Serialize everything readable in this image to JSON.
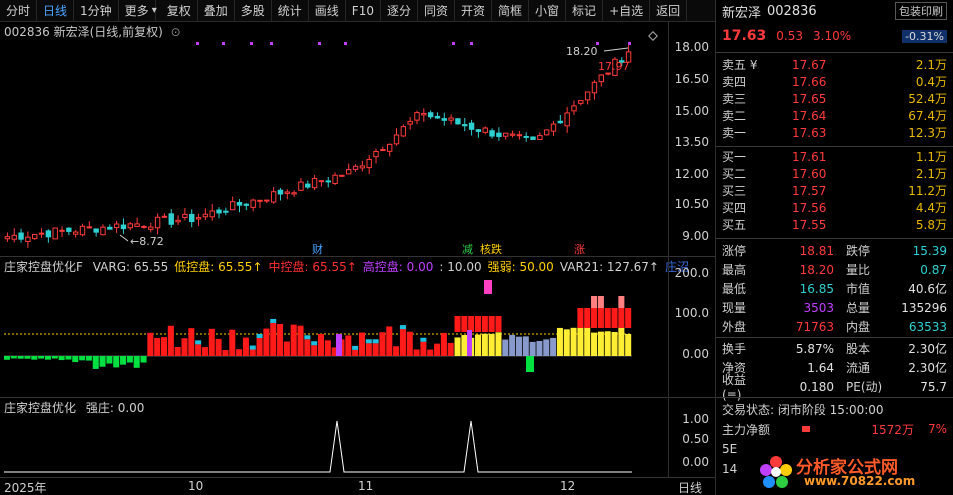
{
  "toolbar": {
    "items": [
      "分时",
      "日线",
      "1分钟",
      "更多",
      "复权",
      "叠加",
      "多股",
      "统计",
      "画线",
      "F10",
      "逐分",
      "同资",
      "开资",
      "简框",
      "小窗",
      "标记",
      "+自选",
      "返回"
    ],
    "active_index": 1,
    "more_caret": "▾"
  },
  "main_chart": {
    "title": "002836 新宏泽(日线,前复权)",
    "circle_icon": "⊙",
    "high_label": "18.20",
    "high_partial": "17.97",
    "low_label": "8.72",
    "markers": [
      "财",
      "减",
      "核跌",
      "涨"
    ],
    "y_ticks": [
      "18.00",
      "16.50",
      "15.00",
      "13.50",
      "12.00",
      "10.50",
      "9.00"
    ]
  },
  "panel2": {
    "title": "庄家控盘优化F",
    "items": [
      {
        "label": "VARG: 65.55",
        "color": "#d0d0d0"
      },
      {
        "label": "低控盘: 65.55↑",
        "color": "#ffd000"
      },
      {
        "label": "中控盘: 65.55↑",
        "color": "#ff3030"
      },
      {
        "label": "高控盘: 0.00",
        "color": "#c040ff"
      },
      {
        "label": ": 10.00",
        "color": "#d0d0d0"
      },
      {
        "label": "强弱: 50.00",
        "color": "#ffd000"
      },
      {
        "label": "VAR21: 127.67↑",
        "color": "#d0d0d0"
      },
      {
        "label": "庄沼",
        "color": "#3a6bd8"
      }
    ],
    "y_ticks": [
      "200.0",
      "100.0",
      "0.00"
    ]
  },
  "panel3": {
    "title": "庄家控盘优化",
    "value": "强庄: 0.00",
    "y_ticks": [
      "1.00",
      "0.50",
      "0.00"
    ]
  },
  "x_axis": [
    "2025年",
    "10",
    "11",
    "12",
    "日线"
  ],
  "quote": {
    "name": "新宏泽",
    "code": "002836",
    "print_btn": "包装印刷",
    "price": "17.63",
    "change": "0.53",
    "change_pct": "3.10%",
    "badge": "-0.31%",
    "sell": [
      {
        "label": "卖五 ¥",
        "price": "17.67",
        "vol": "2.1万"
      },
      {
        "label": "卖四",
        "price": "17.66",
        "vol": "0.4万"
      },
      {
        "label": "卖三",
        "price": "17.65",
        "vol": "52.4万"
      },
      {
        "label": "卖二",
        "price": "17.64",
        "vol": "67.4万"
      },
      {
        "label": "卖一",
        "price": "17.63",
        "vol": "12.3万"
      }
    ],
    "buy": [
      {
        "label": "买一",
        "price": "17.61",
        "vol": "1.1万"
      },
      {
        "label": "买二",
        "price": "17.60",
        "vol": "2.1万"
      },
      {
        "label": "买三",
        "price": "17.57",
        "vol": "11.2万"
      },
      {
        "label": "买四",
        "price": "17.56",
        "vol": "4.4万"
      },
      {
        "label": "买五",
        "price": "17.55",
        "vol": "5.8万"
      }
    ],
    "stats1": [
      {
        "k1": "涨停",
        "v1": "18.81",
        "c1": "red",
        "k2": "跌停",
        "v2": "15.39",
        "c2": "green"
      },
      {
        "k1": "最高",
        "v1": "18.20",
        "c1": "red",
        "k2": "量比",
        "v2": "0.87",
        "c2": "green"
      },
      {
        "k1": "最低",
        "v1": "16.85",
        "c1": "green",
        "k2": "市值",
        "v2": "40.6亿",
        "c2": "white"
      },
      {
        "k1": "现量",
        "v1": "3503",
        "c1": "purple",
        "k2": "总量",
        "v2": "135296",
        "c2": "white"
      },
      {
        "k1": "外盘",
        "v1": "71763",
        "c1": "red",
        "k2": "内盘",
        "v2": "63533",
        "c2": "green"
      }
    ],
    "stats2": [
      {
        "k1": "换手",
        "v1": "5.87%",
        "c1": "white",
        "k2": "股本",
        "v2": "2.30亿",
        "c2": "white"
      },
      {
        "k1": "净资",
        "v1": "1.64",
        "c1": "white",
        "k2": "流通",
        "v2": "2.30亿",
        "c2": "white"
      },
      {
        "k1": "收益(≡)",
        "v1": "0.180",
        "c1": "white",
        "k2": "PE(动)",
        "v2": "75.7",
        "c2": "white"
      }
    ],
    "trade_state": "交易状态: 闭市阶段 15:00:00",
    "main_flow_label": "主力净额",
    "main_flow_value": "1572万",
    "main_flow_pct": "7%",
    "row_5e": "5E",
    "row_14": "14"
  },
  "logo": {
    "text1": "分析家公式网",
    "text2": "www.70822.com"
  },
  "colors": {
    "up": "#ff3b3b",
    "down": "#2fd0d0",
    "accent": "#4aa3ff",
    "yellow": "#ffd000"
  }
}
